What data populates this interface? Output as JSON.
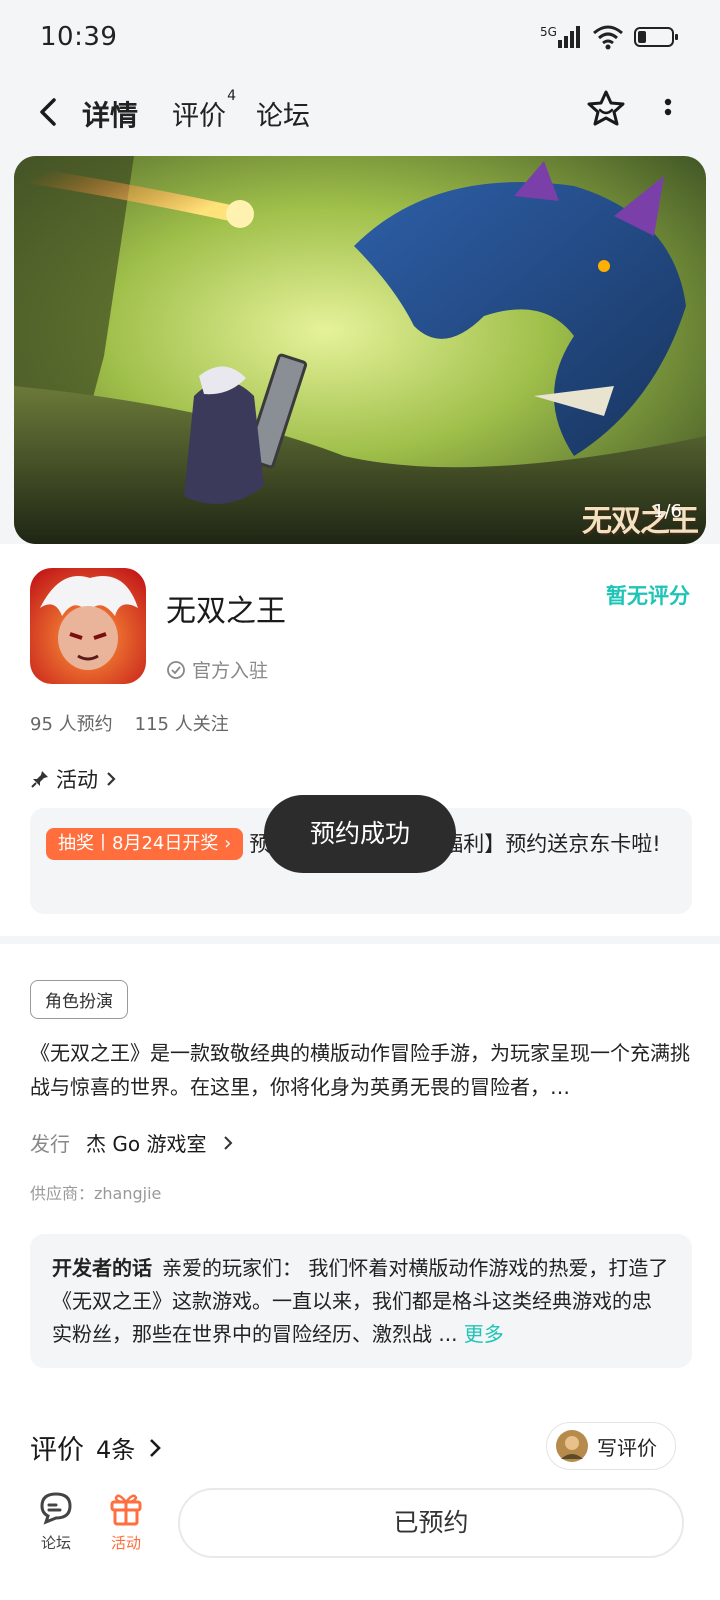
{
  "status_bar": {
    "time": "10:39",
    "network": "5G"
  },
  "nav": {
    "tabs": [
      {
        "label": "详情"
      },
      {
        "label": "评价",
        "badge": "4"
      },
      {
        "label": "论坛"
      }
    ]
  },
  "banner": {
    "counter": "1/6",
    "logo_text": "无双之王"
  },
  "game": {
    "name": "无双之王",
    "official_label": "官方入驻",
    "rating_text": "暂无评分",
    "reservations": "95 人预约",
    "followers": "115 人关注"
  },
  "activity": {
    "heading": "活动",
    "badge": "抽奖丨8月24日开奖",
    "text_prefix": "预",
    "text_suffix": "福利】预约送京东卡啦!"
  },
  "toast": {
    "text": "预约成功"
  },
  "details": {
    "genre_tag": "角色扮演",
    "description": "《无双之王》是一款致敬经典的横版动作冒险手游，为玩家呈现一个充满挑战与惊喜的世界。在这里，你将化身为英勇无畏的冒险者，…",
    "publisher_label": "发行",
    "publisher_value": "杰 Go 游戏室",
    "supplier": "供应商：zhangjie"
  },
  "developer_note": {
    "title": "开发者的话",
    "text": "亲爱的玩家们： 我们怀着对横版动作游戏的热爱，打造了《无双之王》这款游戏。一直以来，我们都是格斗这类经典游戏的忠实粉丝，那些在世界中的冒险经历、激烈战 ...",
    "more_label": "更多"
  },
  "reviews": {
    "title": "评价",
    "count": "4条",
    "write_label": "写评价"
  },
  "bottom_bar": {
    "forum_label": "论坛",
    "activity_label": "活动",
    "reserved_label": "已预约"
  },
  "colors": {
    "accent": "#1ec4b6",
    "orange": "#ff6e3c"
  }
}
